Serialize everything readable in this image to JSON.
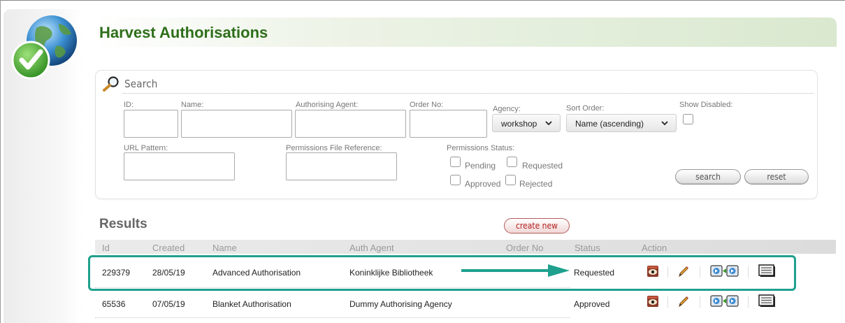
{
  "header": {
    "title": "Harvest Authorisations"
  },
  "search": {
    "title": "Search",
    "fields": {
      "id": {
        "label": "ID:",
        "value": ""
      },
      "name": {
        "label": "Name:",
        "value": ""
      },
      "authorising_agent": {
        "label": "Authorising Agent:",
        "value": ""
      },
      "order_no": {
        "label": "Order No:",
        "value": ""
      },
      "agency": {
        "label": "Agency:",
        "value": "workshop"
      },
      "sort_order": {
        "label": "Sort Order:",
        "value": "Name (ascending)"
      },
      "show_disabled": {
        "label": "Show Disabled:",
        "checked": false
      },
      "url_pattern": {
        "label": "URL Pattern:",
        "value": ""
      },
      "permissions_file_reference": {
        "label": "Permissions File Reference:",
        "value": ""
      },
      "permissions_status": {
        "label": "Permissions Status:",
        "options": [
          {
            "label": "Pending",
            "checked": false
          },
          {
            "label": "Requested",
            "checked": false
          },
          {
            "label": "Approved",
            "checked": false
          },
          {
            "label": "Rejected",
            "checked": false
          }
        ]
      }
    },
    "search_button": "search",
    "reset_button": "reset"
  },
  "results": {
    "title": "Results",
    "create_new": "create new",
    "columns": [
      "Id",
      "Created",
      "Name",
      "Auth Agent",
      "Order No",
      "Status",
      "Action"
    ],
    "rows": [
      {
        "id": "229379",
        "created": "28/05/19",
        "name": "Advanced Authorisation",
        "auth_agent": "Koninklijke Bibliotheek",
        "order_no": "",
        "status": "Requested"
      },
      {
        "id": "65536",
        "created": "07/05/19",
        "name": "Blanket Authorisation",
        "auth_agent": "Dummy Authorising Agency",
        "order_no": "",
        "status": "Approved"
      }
    ],
    "actions": [
      "view-icon",
      "edit-icon",
      "transfer-icon",
      "list-icon"
    ]
  },
  "colors": {
    "title_green": "#2e6e1a",
    "highlight_teal": "#1fa08e",
    "create_new_red": "#b22020"
  }
}
